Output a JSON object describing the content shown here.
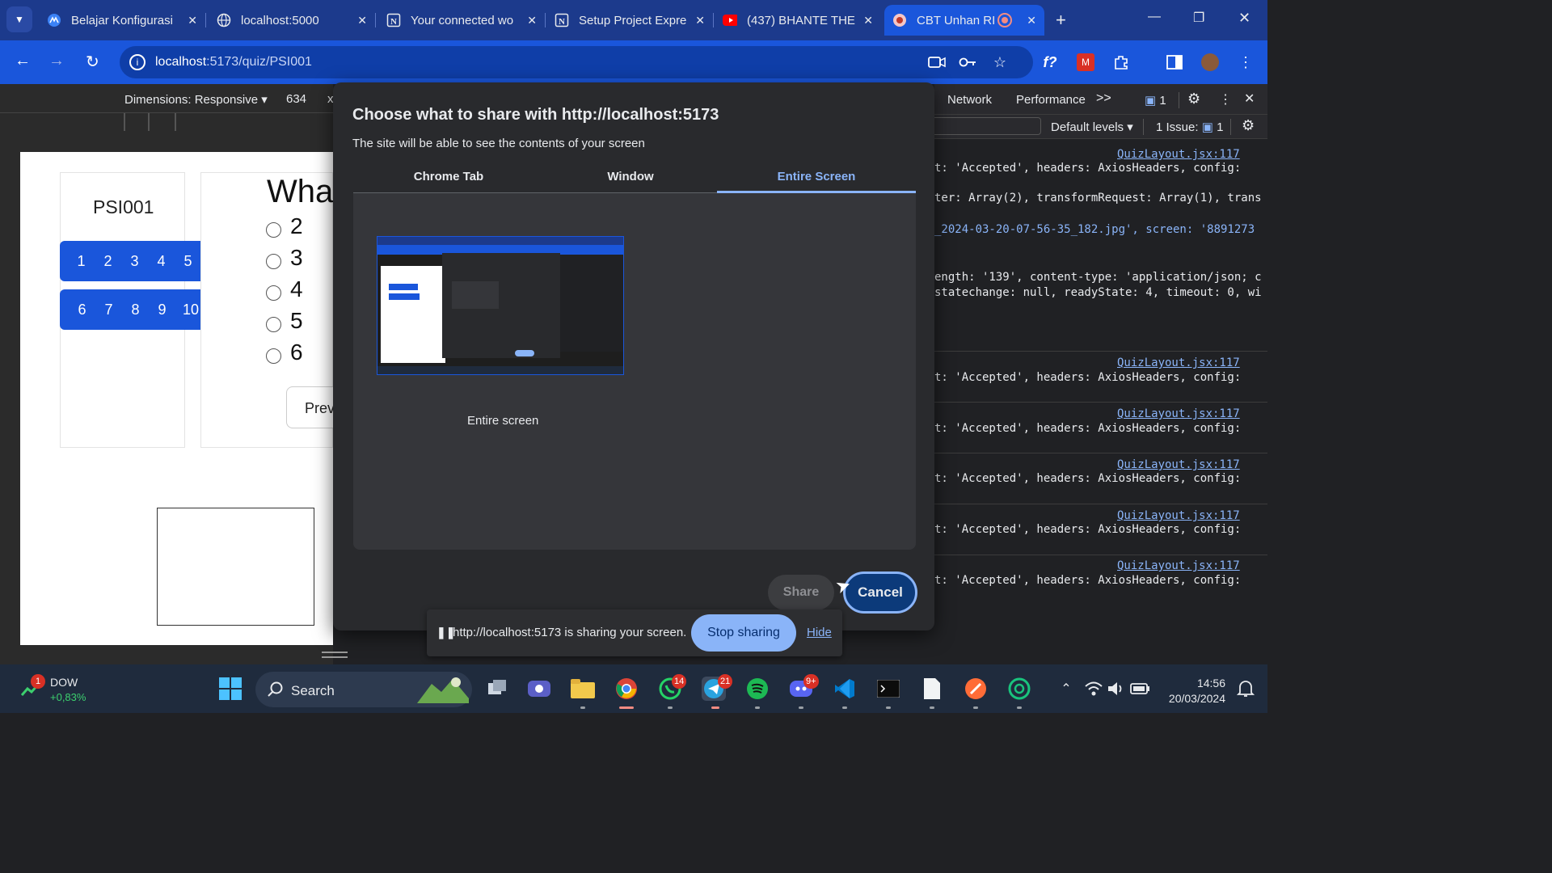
{
  "browser": {
    "tabs": [
      {
        "title": "Belajar Konfigurasi",
        "icon": "logo-icon"
      },
      {
        "title": "localhost:5000",
        "icon": "globe-icon"
      },
      {
        "title": "Your connected wo",
        "icon": "notion-icon"
      },
      {
        "title": "Setup Project Expre",
        "icon": "notion-icon"
      },
      {
        "title": "(437) BHANTE THE",
        "icon": "youtube-icon"
      },
      {
        "title": "CBT Unhan RI",
        "icon": "unhan-icon",
        "active": true
      }
    ],
    "url_host": "localhost",
    "url_path": ":5173/quiz/PSI001"
  },
  "devtools_device": {
    "dimensions_label": "Dimensions: Responsive",
    "width": "634",
    "more": "x"
  },
  "quiz": {
    "code": "PSI001",
    "numbers_row1": [
      "1",
      "2",
      "3",
      "4",
      "5"
    ],
    "numbers_row2": [
      "6",
      "7",
      "8",
      "9",
      "10"
    ],
    "question": "What",
    "options": [
      "2",
      "3",
      "4",
      "5",
      "6"
    ],
    "prev_label": "Prev"
  },
  "devtools": {
    "tabs": [
      "Network",
      "Performance"
    ],
    "more": ">>",
    "message_count": "1",
    "levels_label": "Default levels",
    "issues_label": "1 Issue:",
    "issues_count": "1",
    "source_link": "QuizLayout.jsx:117",
    "log_lines": {
      "l1": "t: 'Accepted', headers: AxiosHeaders, config:",
      "l2": "ter: Array(2), transformRequest: Array(1), trans",
      "l3": "_2024-03-20-07-56-35_182.jpg', screen: '8891273",
      "l4": "ength: '139', content-type: 'application/json; c",
      "l5": "statechange: null, readyState: 4, timeout: 0, wi"
    }
  },
  "share_dialog": {
    "title": "Choose what to share with http://localhost:5173",
    "subtitle": "The site will be able to see the contents of your screen",
    "tabs": [
      "Chrome Tab",
      "Window",
      "Entire Screen"
    ],
    "active_tab": "Entire Screen",
    "source_caption": "Entire screen",
    "share_label": "Share",
    "cancel_label": "Cancel"
  },
  "sharing_bar": {
    "message": "http://localhost:5173 is sharing your screen.",
    "stop_label": "Stop sharing",
    "hide_label": "Hide"
  },
  "taskbar": {
    "stock_name": "DOW",
    "stock_change": "+0,83%",
    "stock_badge": "1",
    "search_label": "Search",
    "whatsapp_badge": "14",
    "telegram_badge": "21",
    "discord_badge": "9+",
    "time": "14:56",
    "date": "20/03/2024"
  },
  "colors": {
    "accent": "#1a56db",
    "link": "#8ab4f8",
    "error_string": "#f28b82"
  }
}
